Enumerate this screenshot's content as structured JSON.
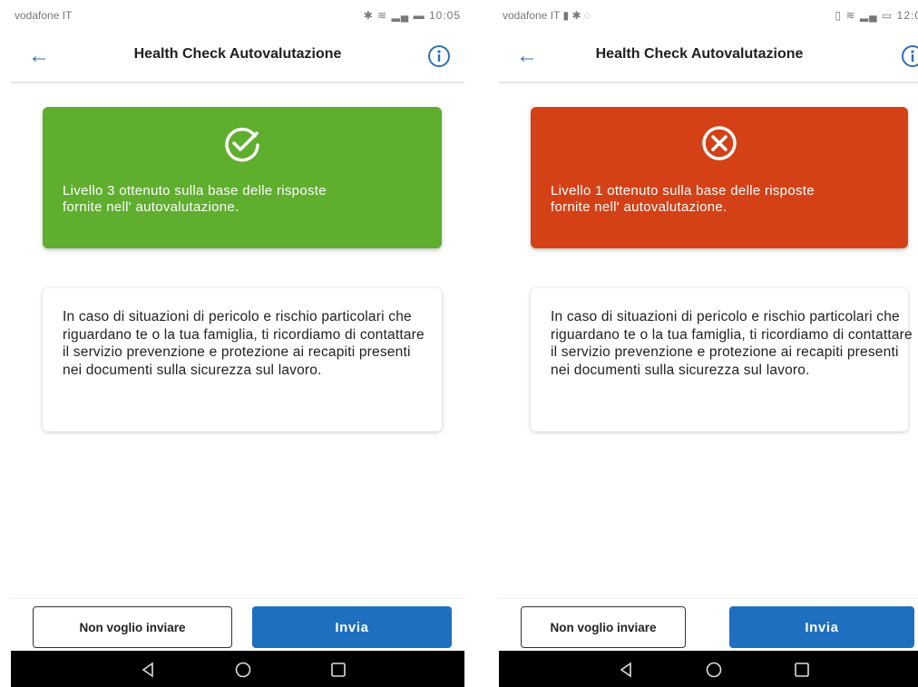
{
  "phones": [
    {
      "carrier": "vodafone IT",
      "status_time": "10:05",
      "header_title": "Health Check Autovalutazione",
      "result": {
        "status": "success",
        "color": "#5fae2e",
        "icon": "check-circle-icon",
        "text": "Livello 3 ottenuto sulla base delle risposte fornite nell' autovalutazione."
      },
      "notice": "In caso di situazioni di pericolo e rischio particolari che riguardano te o la tua famiglia, ti ricordiamo di contattare il servizio prevenzione e protezione ai recapiti presenti nei documenti sulla sicurezza sul lavoro.",
      "buttons": {
        "secondary": "Non voglio inviare",
        "primary": "Invia"
      }
    },
    {
      "carrier": "vodafone IT",
      "status_time": "12:0",
      "header_title": "Health Check Autovalutazione",
      "result": {
        "status": "failure",
        "color": "#d44116",
        "icon": "x-circle-icon",
        "text": "Livello 1 ottenuto sulla base delle risposte fornite nell' autovalutazione."
      },
      "notice": "In caso di situazioni di pericolo e rischio particolari che riguardano te o la tua famiglia, ti ricordiamo di contattare il servizio prevenzione e protezione ai recapiti presenti nei documenti sulla sicurezza sul lavoro.",
      "buttons": {
        "secondary": "Non voglio inviare",
        "primary": "Invia"
      }
    }
  ],
  "colors": {
    "accent": "#1f6fc0",
    "success": "#5fae2e",
    "failure": "#d44116"
  }
}
